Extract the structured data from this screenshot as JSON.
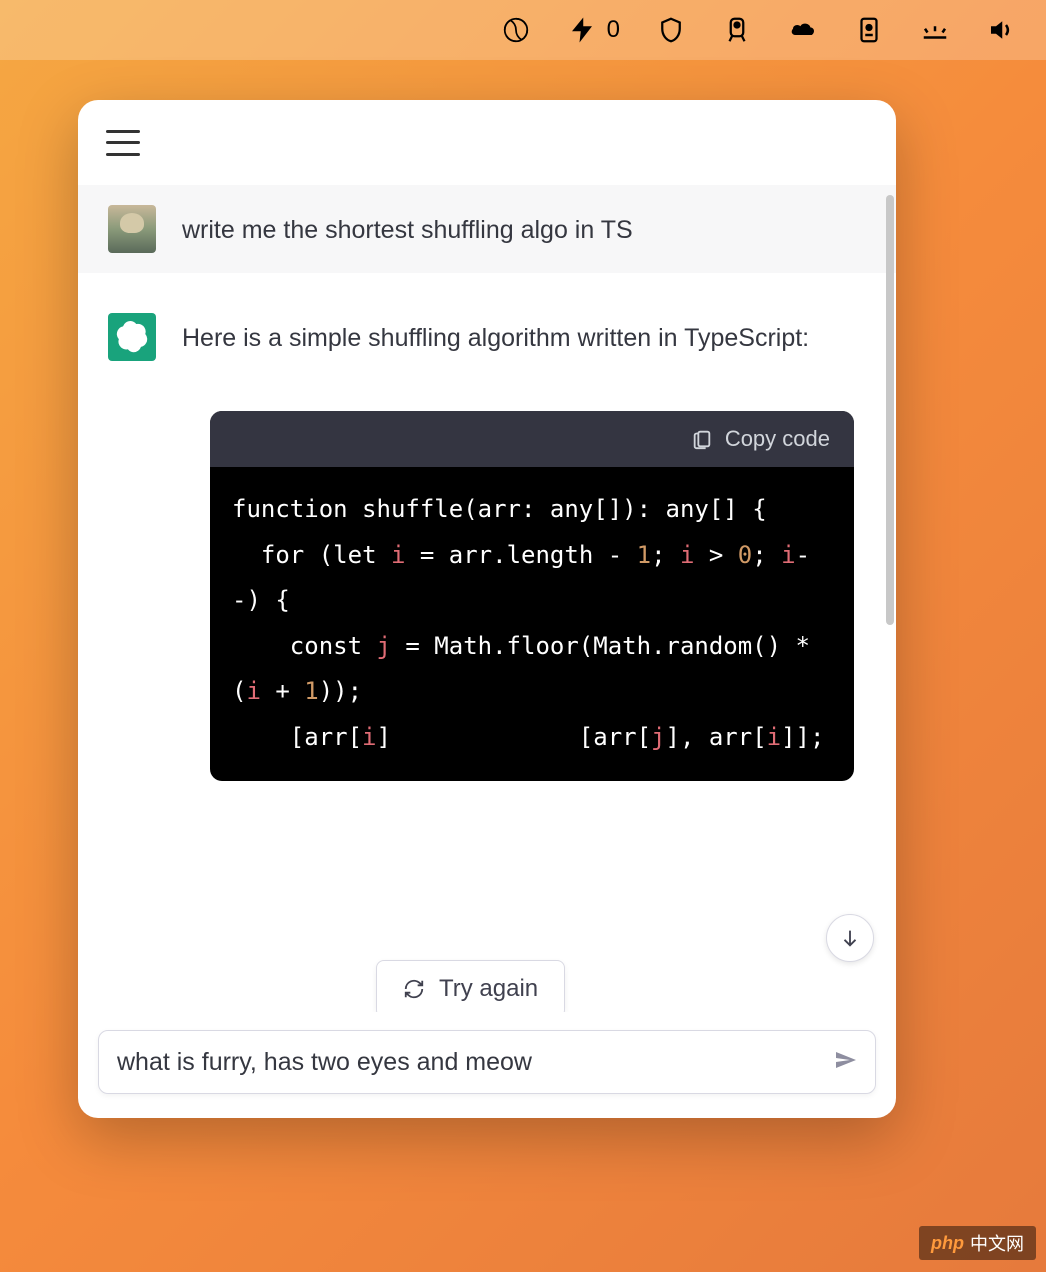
{
  "menubar": {
    "lightning_count": "0"
  },
  "conversation": {
    "user_message": "write me the shortest shuffling algo in TS",
    "assistant_intro": "Here is a simple shuffling algorithm written in TypeScript:",
    "code": {
      "copy_label": "Copy code",
      "tokens": {
        "l1_kw_function": "function",
        "l1_fn": "shuffle",
        "l1_open": "(arr: any[]): any[] {",
        "l2_for": "for",
        "l2_let": "(let",
        "l2_i": "i",
        "l2_eq": " = arr.length - ",
        "l2_one": "1",
        "l2_semi": "; ",
        "l2_i2": "i",
        "l2_gt": " > ",
        "l2_zero": "0",
        "l2_semi2": "; ",
        "l2_i3": "i",
        "l2_dec": "--) {",
        "l3_const": "const",
        "l3_j": "j",
        "l3_eq": " = Math.floor(Math.random() * (",
        "l3_i": "i",
        "l3_plus": " + ",
        "l3_one": "1",
        "l3_close": "));",
        "l4_open": "[arr[",
        "l4_i": "i",
        "l4_gap": "]             ",
        "l4_sw": "[arr[",
        "l4_j": "j",
        "l4_close": "], arr[",
        "l4_i2": "i",
        "l4_end": "]];"
      }
    },
    "try_again_label": "Try again"
  },
  "input": {
    "value": "what is furry, has two eyes and meow"
  },
  "watermark": {
    "brand": "php",
    "site": "中文网"
  }
}
